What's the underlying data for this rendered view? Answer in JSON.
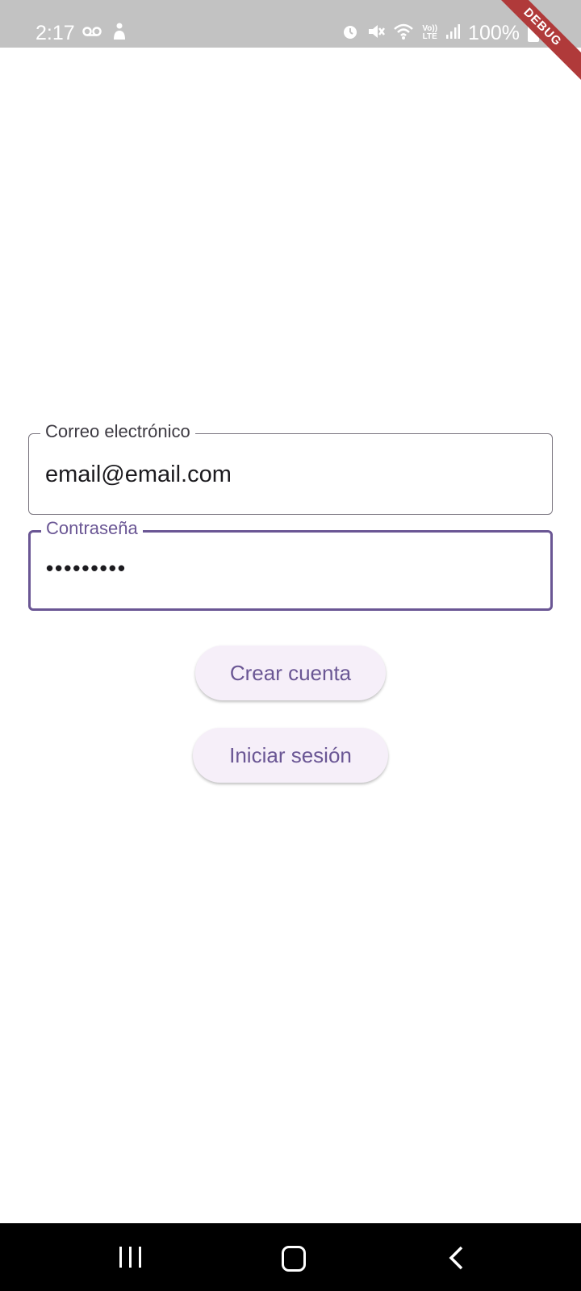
{
  "status_bar": {
    "time": "2:17",
    "battery_percent": "100%",
    "lte_label": "LTE",
    "volte_label": "Vo))",
    "icons": [
      "voicemail-icon",
      "accessibility-icon",
      "alarm-icon",
      "mute-icon",
      "wifi-icon",
      "signal-icon",
      "battery-icon"
    ]
  },
  "debug_banner": "DEBUG",
  "form": {
    "email": {
      "label": "Correo electrónico",
      "value": "email@email.com"
    },
    "password": {
      "label": "Contraseña",
      "value": "•••••••••"
    }
  },
  "buttons": {
    "create_account": "Crear cuenta",
    "login": "Iniciar sesión"
  },
  "nav_bar": {
    "icons": [
      "recents-icon",
      "home-icon",
      "back-icon"
    ]
  },
  "colors": {
    "accent": "#6a5694",
    "button_bg": "#f6eff9",
    "status_bar_bg": "#c2c2c2",
    "debug_ribbon": "#b03a3a"
  }
}
